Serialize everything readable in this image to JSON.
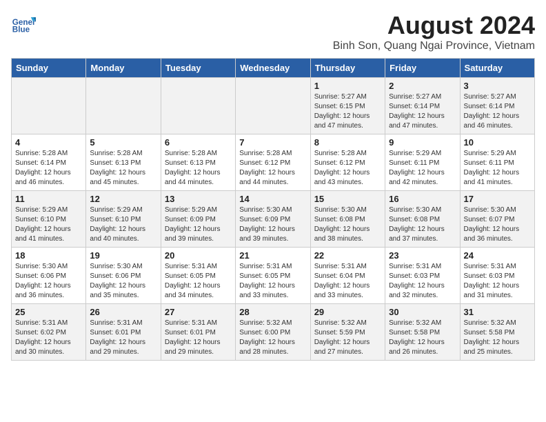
{
  "header": {
    "logo_line1": "General",
    "logo_line2": "Blue",
    "title": "August 2024",
    "subtitle": "Binh Son, Quang Ngai Province, Vietnam"
  },
  "days_of_week": [
    "Sunday",
    "Monday",
    "Tuesday",
    "Wednesday",
    "Thursday",
    "Friday",
    "Saturday"
  ],
  "weeks": [
    [
      {
        "day": "",
        "info": ""
      },
      {
        "day": "",
        "info": ""
      },
      {
        "day": "",
        "info": ""
      },
      {
        "day": "",
        "info": ""
      },
      {
        "day": "1",
        "info": "Sunrise: 5:27 AM\nSunset: 6:15 PM\nDaylight: 12 hours\nand 47 minutes."
      },
      {
        "day": "2",
        "info": "Sunrise: 5:27 AM\nSunset: 6:14 PM\nDaylight: 12 hours\nand 47 minutes."
      },
      {
        "day": "3",
        "info": "Sunrise: 5:27 AM\nSunset: 6:14 PM\nDaylight: 12 hours\nand 46 minutes."
      }
    ],
    [
      {
        "day": "4",
        "info": "Sunrise: 5:28 AM\nSunset: 6:14 PM\nDaylight: 12 hours\nand 46 minutes."
      },
      {
        "day": "5",
        "info": "Sunrise: 5:28 AM\nSunset: 6:13 PM\nDaylight: 12 hours\nand 45 minutes."
      },
      {
        "day": "6",
        "info": "Sunrise: 5:28 AM\nSunset: 6:13 PM\nDaylight: 12 hours\nand 44 minutes."
      },
      {
        "day": "7",
        "info": "Sunrise: 5:28 AM\nSunset: 6:12 PM\nDaylight: 12 hours\nand 44 minutes."
      },
      {
        "day": "8",
        "info": "Sunrise: 5:28 AM\nSunset: 6:12 PM\nDaylight: 12 hours\nand 43 minutes."
      },
      {
        "day": "9",
        "info": "Sunrise: 5:29 AM\nSunset: 6:11 PM\nDaylight: 12 hours\nand 42 minutes."
      },
      {
        "day": "10",
        "info": "Sunrise: 5:29 AM\nSunset: 6:11 PM\nDaylight: 12 hours\nand 41 minutes."
      }
    ],
    [
      {
        "day": "11",
        "info": "Sunrise: 5:29 AM\nSunset: 6:10 PM\nDaylight: 12 hours\nand 41 minutes."
      },
      {
        "day": "12",
        "info": "Sunrise: 5:29 AM\nSunset: 6:10 PM\nDaylight: 12 hours\nand 40 minutes."
      },
      {
        "day": "13",
        "info": "Sunrise: 5:29 AM\nSunset: 6:09 PM\nDaylight: 12 hours\nand 39 minutes."
      },
      {
        "day": "14",
        "info": "Sunrise: 5:30 AM\nSunset: 6:09 PM\nDaylight: 12 hours\nand 39 minutes."
      },
      {
        "day": "15",
        "info": "Sunrise: 5:30 AM\nSunset: 6:08 PM\nDaylight: 12 hours\nand 38 minutes."
      },
      {
        "day": "16",
        "info": "Sunrise: 5:30 AM\nSunset: 6:08 PM\nDaylight: 12 hours\nand 37 minutes."
      },
      {
        "day": "17",
        "info": "Sunrise: 5:30 AM\nSunset: 6:07 PM\nDaylight: 12 hours\nand 36 minutes."
      }
    ],
    [
      {
        "day": "18",
        "info": "Sunrise: 5:30 AM\nSunset: 6:06 PM\nDaylight: 12 hours\nand 36 minutes."
      },
      {
        "day": "19",
        "info": "Sunrise: 5:30 AM\nSunset: 6:06 PM\nDaylight: 12 hours\nand 35 minutes."
      },
      {
        "day": "20",
        "info": "Sunrise: 5:31 AM\nSunset: 6:05 PM\nDaylight: 12 hours\nand 34 minutes."
      },
      {
        "day": "21",
        "info": "Sunrise: 5:31 AM\nSunset: 6:05 PM\nDaylight: 12 hours\nand 33 minutes."
      },
      {
        "day": "22",
        "info": "Sunrise: 5:31 AM\nSunset: 6:04 PM\nDaylight: 12 hours\nand 33 minutes."
      },
      {
        "day": "23",
        "info": "Sunrise: 5:31 AM\nSunset: 6:03 PM\nDaylight: 12 hours\nand 32 minutes."
      },
      {
        "day": "24",
        "info": "Sunrise: 5:31 AM\nSunset: 6:03 PM\nDaylight: 12 hours\nand 31 minutes."
      }
    ],
    [
      {
        "day": "25",
        "info": "Sunrise: 5:31 AM\nSunset: 6:02 PM\nDaylight: 12 hours\nand 30 minutes."
      },
      {
        "day": "26",
        "info": "Sunrise: 5:31 AM\nSunset: 6:01 PM\nDaylight: 12 hours\nand 29 minutes."
      },
      {
        "day": "27",
        "info": "Sunrise: 5:31 AM\nSunset: 6:01 PM\nDaylight: 12 hours\nand 29 minutes."
      },
      {
        "day": "28",
        "info": "Sunrise: 5:32 AM\nSunset: 6:00 PM\nDaylight: 12 hours\nand 28 minutes."
      },
      {
        "day": "29",
        "info": "Sunrise: 5:32 AM\nSunset: 5:59 PM\nDaylight: 12 hours\nand 27 minutes."
      },
      {
        "day": "30",
        "info": "Sunrise: 5:32 AM\nSunset: 5:58 PM\nDaylight: 12 hours\nand 26 minutes."
      },
      {
        "day": "31",
        "info": "Sunrise: 5:32 AM\nSunset: 5:58 PM\nDaylight: 12 hours\nand 25 minutes."
      }
    ]
  ]
}
